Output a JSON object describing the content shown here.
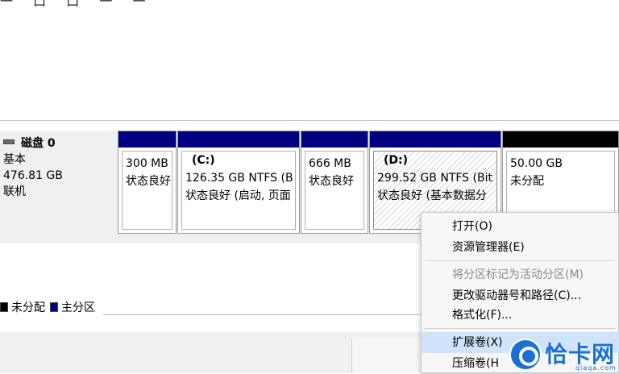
{
  "top_partial": [
    "一",
    "口",
    "口",
    "一",
    "一"
  ],
  "disk": {
    "name": "磁盘 0",
    "type": "基本",
    "size": "476.81 GB",
    "status": "联机"
  },
  "partitions": [
    {
      "label": "",
      "size": "300 MB",
      "status": "状态良好",
      "bar": "primary"
    },
    {
      "label": "(C:)",
      "size": "126.35 GB NTFS (B",
      "status": "状态良好 (启动, 页面",
      "bar": "primary"
    },
    {
      "label": "",
      "size": "666 MB",
      "status": "状态良好",
      "bar": "primary"
    },
    {
      "label": "(D:)",
      "size": "299.52 GB NTFS (Bit",
      "status": "状态良好 (基本数据分",
      "bar": "primary"
    },
    {
      "label": "",
      "size": "50.00 GB",
      "status": "未分配",
      "bar": "unallocated"
    }
  ],
  "legend": {
    "unallocated": "未分配",
    "primary": "主分区"
  },
  "context_menu": {
    "items": [
      {
        "label": "打开(O)",
        "enabled": true
      },
      {
        "label": "资源管理器(E)",
        "enabled": true
      },
      {
        "label": "将分区标记为活动分区(M)",
        "enabled": false
      },
      {
        "label": "更改驱动器号和路径(C)...",
        "enabled": true
      },
      {
        "label": "格式化(F)...",
        "enabled": true
      },
      {
        "label": "扩展卷(X)",
        "enabled": true,
        "highlighted": true
      },
      {
        "label": "压缩卷(H",
        "enabled": true
      }
    ]
  },
  "watermark": {
    "text": "恰卡网",
    "sub": "qiaqa.com"
  },
  "colors": {
    "primary_partition": "#000080",
    "unallocated": "#000000",
    "menu_highlight": "#cfe3fb",
    "watermark": "#1a6fd6"
  },
  "icons": {
    "disk": "disk-icon",
    "watermark_logo": "logo-circle-icon"
  }
}
